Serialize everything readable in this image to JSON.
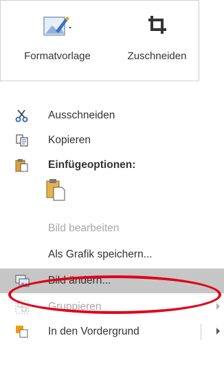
{
  "toolbar": {
    "style_label": "Formatvorlage",
    "crop_label": "Zuschneiden"
  },
  "menu": {
    "items": [
      {
        "label": "Ausschneiden",
        "icon": "scissors-icon",
        "enabled": true
      },
      {
        "label": "Kopieren",
        "icon": "copy-icon",
        "enabled": true
      },
      {
        "label": "Einfügeoptionen:",
        "icon": "paste-icon",
        "enabled": true
      },
      {
        "label": "Bild bearbeiten",
        "enabled": false
      },
      {
        "label": "Als Grafik speichern...",
        "enabled": true
      },
      {
        "label": "Bild ändern...",
        "icon": "change-picture-icon",
        "enabled": true,
        "highlighted": true
      },
      {
        "label": "Gruppieren",
        "icon": "group-icon",
        "enabled": false
      },
      {
        "label": "In den Vordergrund",
        "icon": "bring-forward-icon",
        "enabled": true
      }
    ]
  },
  "colors": {
    "highlight": "#c6c6c6",
    "annotation_oval": "#e0001a",
    "accent_orange": "#f0a000"
  }
}
